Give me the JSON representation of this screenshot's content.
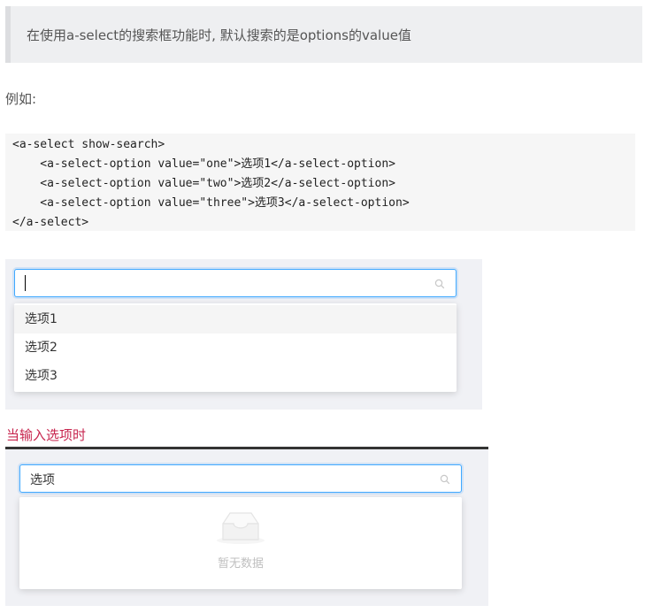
{
  "note": {
    "text": "在使用a-select的搜索框功能时, 默认搜索的是options的value值"
  },
  "example_label": "例如:",
  "code": {
    "lines": [
      "<a-select show-search>",
      "    <a-select-option value=\"one\">选项1</a-select-option>",
      "    <a-select-option value=\"two\">选项2</a-select-option>",
      "    <a-select-option value=\"three\">选项3</a-select-option>",
      "</a-select>"
    ]
  },
  "demo1": {
    "input_value": "",
    "options": [
      "选项1",
      "选项2",
      "选项3"
    ],
    "active_index": 0,
    "icon": "search-icon"
  },
  "caption": "当输入选项时",
  "demo2": {
    "input_value": "选项",
    "empty_text": "暂无数据",
    "icon": "search-icon",
    "empty_icon": "inbox-icon"
  },
  "colors": {
    "accent": "#40a9ff",
    "caption": "#c7254e",
    "panel": "#f0f1f5"
  }
}
